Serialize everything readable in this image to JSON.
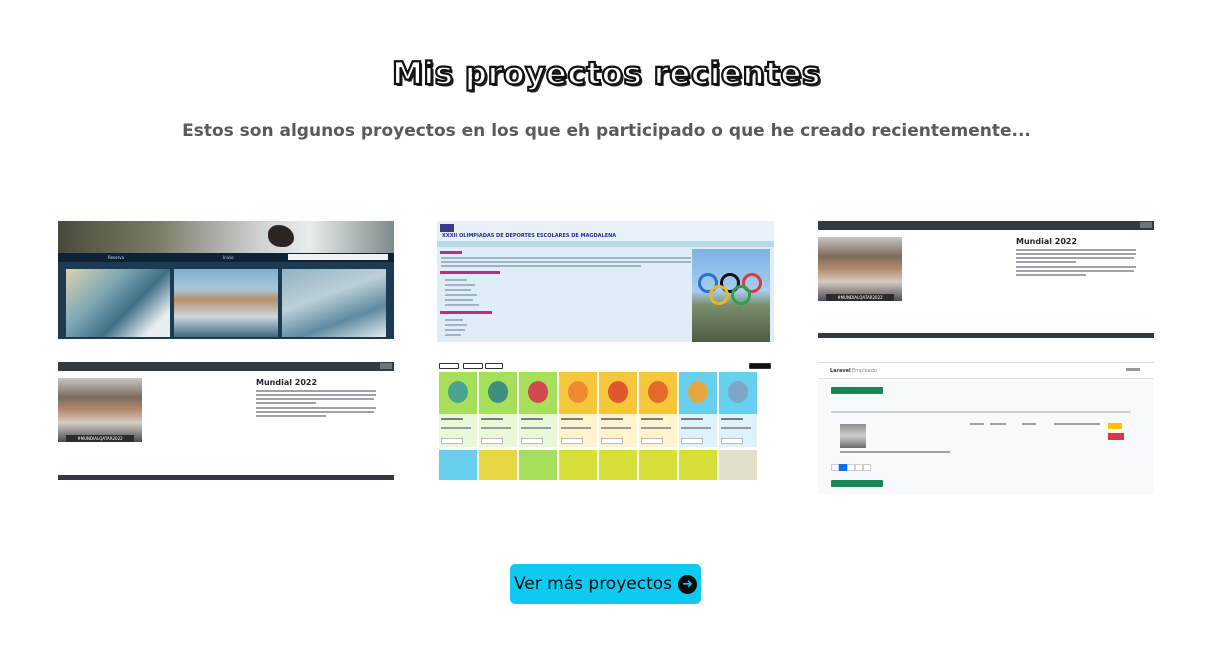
{
  "header": {
    "title": "Mis proyectos recientes",
    "subtitle": "Estos son algunos proyectos en los que eh participado o que he creado recientemente..."
  },
  "projects": [
    {
      "name": "surf-site",
      "preview_texts": {
        "nav_1": "Reserva",
        "nav_2": "Inicio"
      }
    },
    {
      "name": "olympics-site",
      "preview_texts": {
        "heading": "XXXII OLIMPIADAS DE DEPORTES ESCOLARES DE MAGDALENA"
      }
    },
    {
      "name": "mundial-2022-site",
      "preview_texts": {
        "heading": "Mundial 2022",
        "caption": "#MUNDIALQATAR2022"
      }
    },
    {
      "name": "mundial-2022-site-alt",
      "preview_texts": {
        "heading": "Mundial 2022",
        "caption": "#MUNDIALQATAR2022"
      }
    },
    {
      "name": "pokemon-app",
      "preview_texts": {}
    },
    {
      "name": "laravel-crud",
      "preview_texts": {
        "brand": "Laravel",
        "nav_item": "Empleado"
      }
    }
  ],
  "cta": {
    "label": "Ver más proyectos",
    "icon": "arrow-right-circle-icon"
  },
  "colors": {
    "cta_background": "#0dcaf0",
    "subtitle": "#5a5a5a"
  }
}
